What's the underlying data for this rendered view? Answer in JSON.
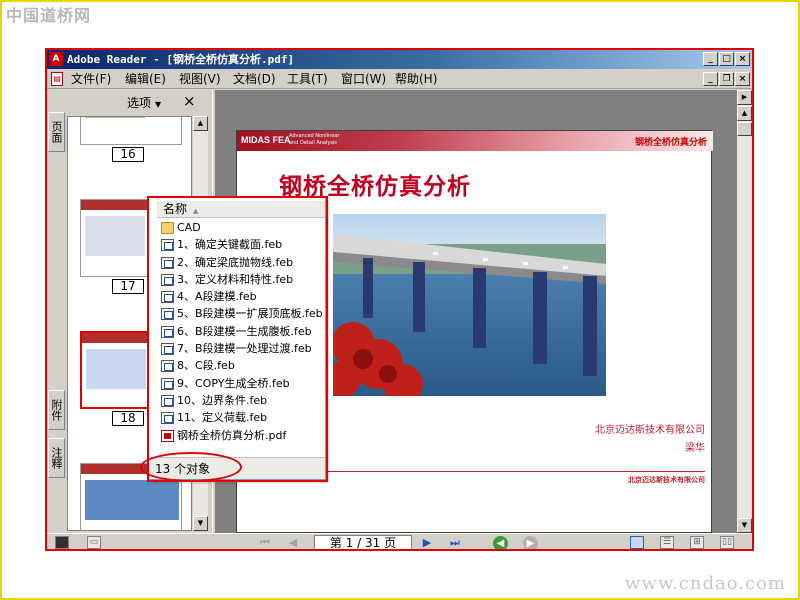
{
  "site": {
    "logo_text": "中国道桥网",
    "url_text": "www.cndao.com"
  },
  "window": {
    "title": "Adobe Reader - [钢桥全桥仿真分析.pdf]",
    "controls": [
      "_",
      "□",
      "×"
    ],
    "doc_controls": [
      "_",
      "❐",
      "×"
    ]
  },
  "menu": {
    "items": [
      "文件(F)",
      "编辑(E)",
      "视图(V)",
      "文档(D)",
      "工具(T)",
      "窗口(W)",
      "帮助(H)"
    ]
  },
  "left_panel": {
    "tabs": [
      "页面",
      "附件",
      "注释"
    ],
    "options_label": "选项",
    "close_label": "×",
    "thumbnails": [
      {
        "page": "16",
        "selected": false
      },
      {
        "page": "17",
        "selected": false
      },
      {
        "page": "18",
        "selected": true
      }
    ]
  },
  "page": {
    "brand": "MIDAS FEA",
    "brand_sub": "Advanced Nonlinear and Detail Analysis",
    "header_title": "钢桥全桥仿真分析",
    "title": "钢桥全桥仿真分析",
    "company": "北京迈达斯技术有限公司",
    "author": "梁华",
    "footer": "北京迈达斯技术有限公司"
  },
  "attachments_popup": {
    "column_header": "名称",
    "files": [
      {
        "name": "CAD",
        "type": "folder"
      },
      {
        "name": "1、确定关键截面.feb",
        "type": "feb"
      },
      {
        "name": "2、确定梁底抛物线.feb",
        "type": "feb"
      },
      {
        "name": "3、定义材料和特性.feb",
        "type": "feb"
      },
      {
        "name": "4、A段建模.feb",
        "type": "feb"
      },
      {
        "name": "5、B段建模一扩展顶底板.feb",
        "type": "feb"
      },
      {
        "name": "6、B段建模一生成腹板.feb",
        "type": "feb"
      },
      {
        "name": "7、B段建模一处理过渡.feb",
        "type": "feb"
      },
      {
        "name": "8、C段.feb",
        "type": "feb"
      },
      {
        "name": "9、COPY生成全桥.feb",
        "type": "feb"
      },
      {
        "name": "10、边界条件.feb",
        "type": "feb"
      },
      {
        "name": "11、定义荷载.feb",
        "type": "feb"
      },
      {
        "name": "钢桥全桥仿真分析.pdf",
        "type": "pdf"
      }
    ],
    "status": "13 个对象"
  },
  "statusbar": {
    "page_indicator": "第 1 / 31 页",
    "current_page": 1,
    "total_pages": 31
  },
  "colors": {
    "highlight": "#e00000",
    "title_bar": "#0a246a",
    "page_title": "#c00020"
  }
}
